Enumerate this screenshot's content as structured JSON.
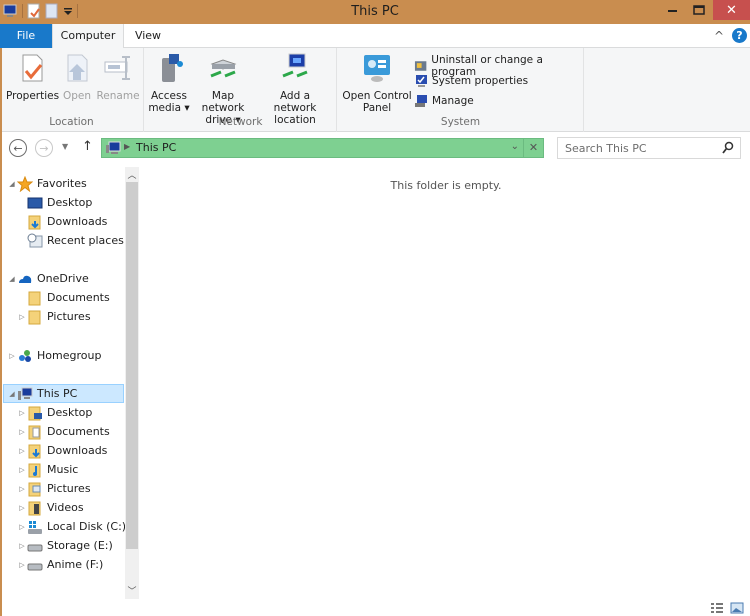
{
  "window": {
    "title": "This PC",
    "accent_color": "#c98d4f",
    "quick_access": [
      "computer-icon",
      "properties-icon",
      "new-folder-icon",
      "customize-qat-icon"
    ],
    "controls": {
      "minimize": "–",
      "maximize": "□",
      "close": "✕"
    }
  },
  "ribbon_tabs": [
    {
      "label": "File",
      "active": false
    },
    {
      "label": "Computer",
      "active": true
    },
    {
      "label": "View",
      "active": false
    }
  ],
  "help": {
    "collapse": "^",
    "help": "?"
  },
  "ribbon": {
    "groups": [
      {
        "label": "Location",
        "buttons": [
          {
            "label": "Properties",
            "enabled": true
          },
          {
            "label": "Open",
            "enabled": false
          },
          {
            "label": "Rename",
            "enabled": false
          }
        ]
      },
      {
        "label": "Network",
        "buttons": [
          {
            "label": "Access media",
            "line1": "Access",
            "line2": "media ▾",
            "enabled": true
          },
          {
            "label": "Map network drive",
            "line1": "Map network",
            "line2": "drive ▾",
            "enabled": true
          },
          {
            "label": "Add a network location",
            "line1": "Add a network",
            "line2": "location",
            "enabled": true
          }
        ]
      },
      {
        "label": "System",
        "buttons": [
          {
            "label": "Open Control Panel",
            "line1": "Open Control",
            "line2": "Panel",
            "enabled": true
          },
          {
            "label": "Uninstall or change a program",
            "enabled": true
          },
          {
            "label": "System properties",
            "enabled": true
          },
          {
            "label": "Manage",
            "enabled": true
          }
        ]
      }
    ]
  },
  "address_bar": {
    "crumbs": [
      "This PC"
    ],
    "highlight_color": "#7ed091",
    "search_placeholder": "Search This PC"
  },
  "nav_pane": {
    "favorites": {
      "label": "Favorites",
      "items": [
        "Desktop",
        "Downloads",
        "Recent places"
      ]
    },
    "onedrive": {
      "label": "OneDrive",
      "items": [
        "Documents",
        "Pictures"
      ]
    },
    "homegroup": {
      "label": "Homegroup"
    },
    "thispc": {
      "label": "This PC",
      "selected": true,
      "items": [
        "Desktop",
        "Documents",
        "Downloads",
        "Music",
        "Pictures",
        "Videos",
        "Local Disk (C:)",
        "Storage (E:)",
        "Anime (F:)"
      ]
    }
  },
  "content": {
    "empty_message": "This folder is empty."
  },
  "status": {
    "views": [
      "details-view",
      "large-icons-view"
    ]
  }
}
